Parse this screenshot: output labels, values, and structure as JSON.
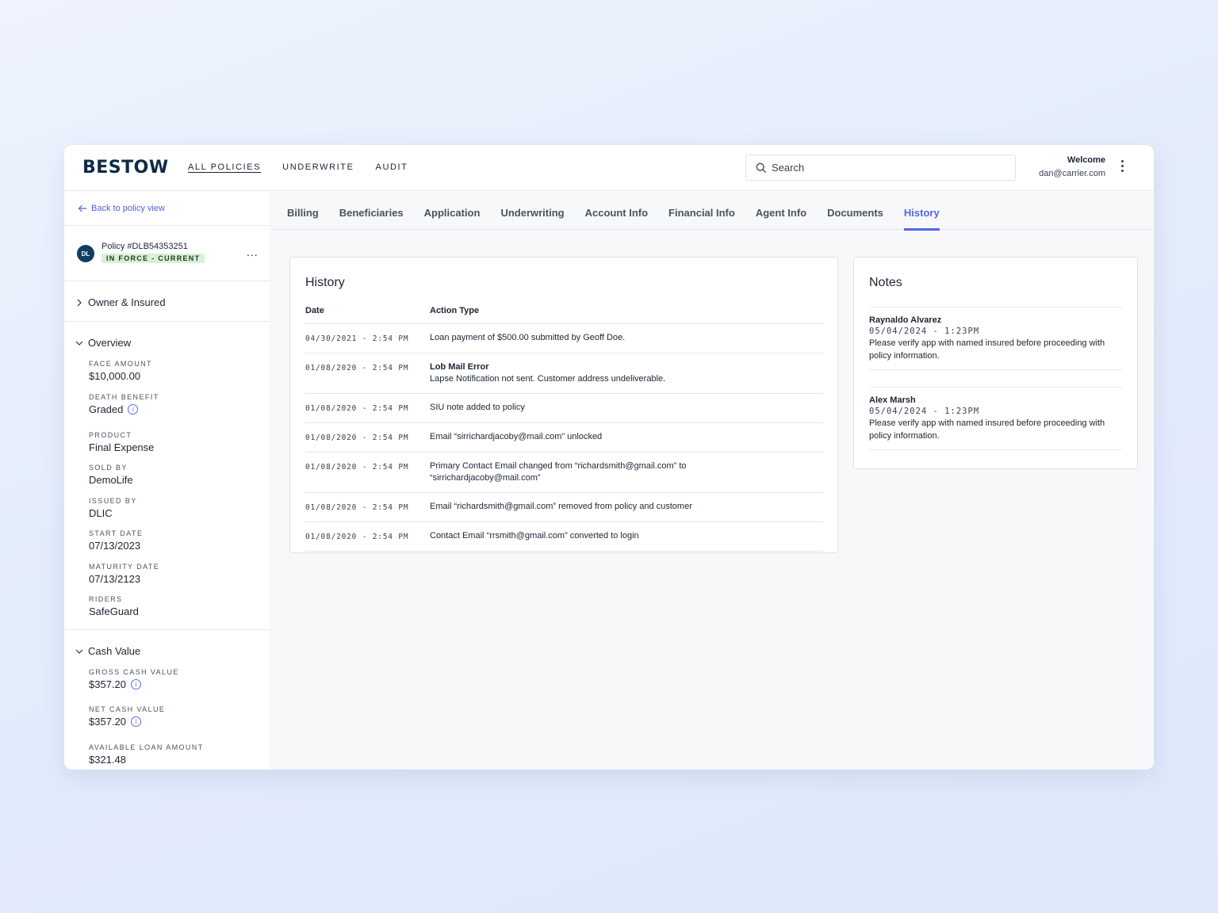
{
  "header": {
    "logo": "BESTOW",
    "nav": [
      "ALL POLICIES",
      "UNDERWRITE",
      "AUDIT"
    ],
    "search_placeholder": "Search",
    "welcome": "Welcome",
    "user_email": "dan@carrier.com"
  },
  "sidebar": {
    "back_label": "Back to policy view",
    "avatar_initials": "DL",
    "policy_id": "Policy #DLB54353251",
    "status": "IN FORCE - CURRENT",
    "more": "...",
    "owner_section": "Owner & Insured",
    "overview_section": "Overview",
    "overview": [
      {
        "label": "FACE AMOUNT",
        "value": "$10,000.00"
      },
      {
        "label": "DEATH BENEFIT",
        "value": "Graded"
      },
      {
        "label": "PRODUCT",
        "value": "Final Expense"
      },
      {
        "label": "SOLD BY",
        "value": "DemoLife"
      },
      {
        "label": "ISSUED BY",
        "value": "DLIC"
      },
      {
        "label": "START DATE",
        "value": "07/13/2023"
      },
      {
        "label": "MATURITY DATE",
        "value": "07/13/2123"
      },
      {
        "label": "RIDERS",
        "value": "SafeGuard"
      }
    ],
    "cash_section": "Cash Value",
    "cash": [
      {
        "label": "GROSS CASH VALUE",
        "value": "$357.20"
      },
      {
        "label": "NET CASH VALUE",
        "value": "$357.20"
      },
      {
        "label": "AVAILABLE LOAN AMOUNT",
        "value": "$321.48"
      }
    ]
  },
  "tabs": [
    "Billing",
    "Beneficiaries",
    "Application",
    "Underwriting",
    "Account Info",
    "Financial Info",
    "Agent Info",
    "Documents",
    "History"
  ],
  "active_tab": "History",
  "history": {
    "title": "History",
    "columns": [
      "Date",
      "Action Type"
    ],
    "rows": [
      {
        "date": "04/30/2021 - 2:54 PM",
        "title": "",
        "action": "Loan payment of $500.00 submitted by Geoff Doe."
      },
      {
        "date": "01/08/2020 - 2:54 PM",
        "title": "Lob Mail Error",
        "action": "Lapse Notification not sent. Customer address undeliverable."
      },
      {
        "date": "01/08/2020 - 2:54 PM",
        "title": "",
        "action": "SIU note added to policy"
      },
      {
        "date": "01/08/2020 - 2:54 PM",
        "title": "",
        "action": "Email “sirrichardjacoby@mail.com” unlocked"
      },
      {
        "date": "01/08/2020 - 2:54 PM",
        "title": "",
        "action": "Primary Contact Email changed from “richardsmith@gmail.com” to “sirrichardjacoby@mail.com”"
      },
      {
        "date": "01/08/2020 - 2:54 PM",
        "title": "",
        "action": "Email “richardsmith@gmail.com” removed from policy and customer"
      },
      {
        "date": "01/08/2020 - 2:54 PM",
        "title": "",
        "action": "Contact Email “rrsmith@gmail.com” converted to login"
      }
    ]
  },
  "notes": {
    "title": "Notes",
    "items": [
      {
        "author": "Raynaldo Alvarez",
        "time": "05/04/2024  -  1:23PM",
        "body": "Please verify app with named insured before proceeding with policy information."
      },
      {
        "author": "Alex Marsh",
        "time": "05/04/2024  -  1:23PM",
        "body": "Please verify app with named insured before proceeding with policy information."
      }
    ]
  },
  "colors": {
    "accent": "#5468e8",
    "brand": "#0f2a47",
    "badge_bg": "#d8f0d8"
  }
}
